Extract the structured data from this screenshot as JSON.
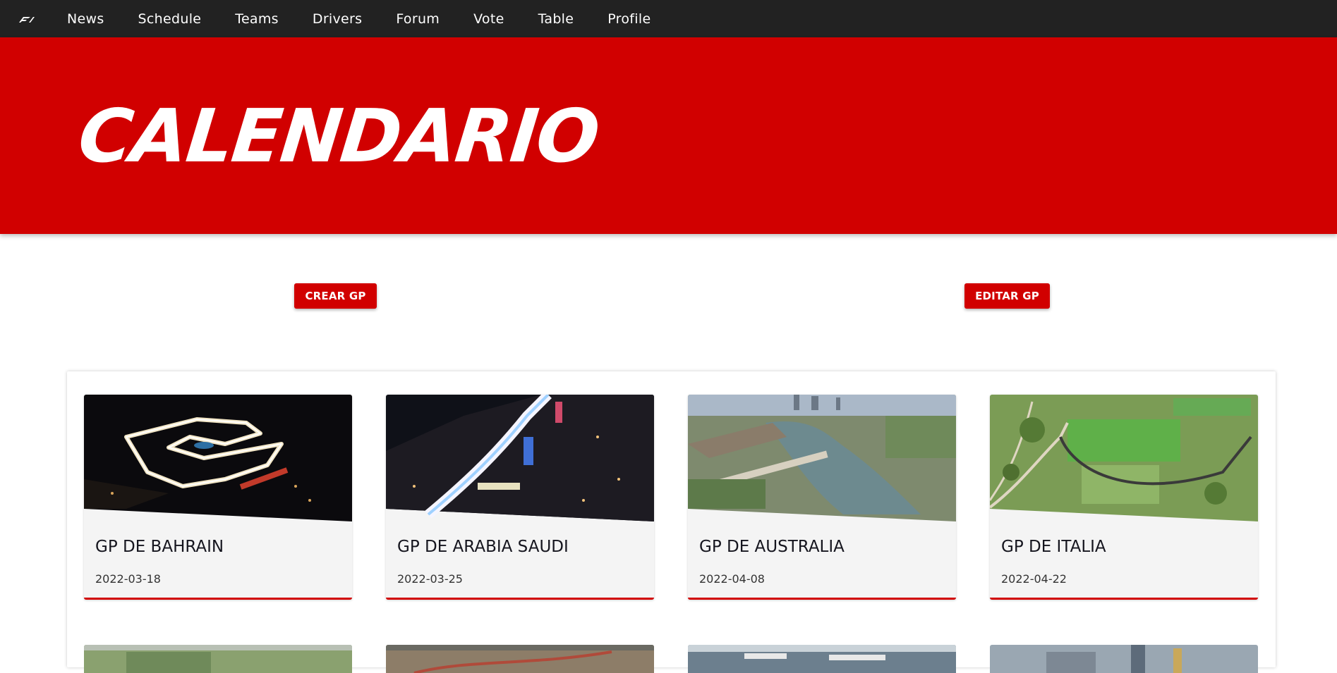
{
  "nav": {
    "logo_icon": "f1-logo-icon",
    "items": [
      {
        "label": "News"
      },
      {
        "label": "Schedule"
      },
      {
        "label": "Teams"
      },
      {
        "label": "Drivers"
      },
      {
        "label": "Forum"
      },
      {
        "label": "Vote"
      },
      {
        "label": "Table"
      },
      {
        "label": "Profile"
      }
    ]
  },
  "hero": {
    "title": "CALENDARIO"
  },
  "actions": {
    "create_label": "CREAR GP",
    "edit_label": "EDITAR GP"
  },
  "colors": {
    "accent": "#d10000",
    "nav_bg": "#222222",
    "card_bg": "#f4f4f4"
  },
  "races": [
    {
      "name": "GP DE BAHRAIN",
      "date": "2022-03-18"
    },
    {
      "name": "GP DE ARABIA SAUDI",
      "date": "2022-03-25"
    },
    {
      "name": "GP DE AUSTRALIA",
      "date": "2022-04-08"
    },
    {
      "name": "GP DE ITALIA",
      "date": "2022-04-22"
    }
  ]
}
